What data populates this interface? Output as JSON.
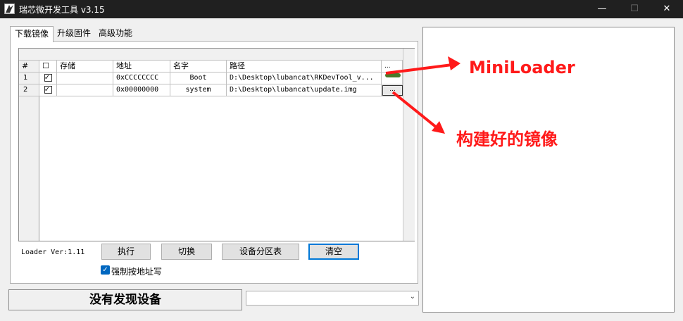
{
  "window": {
    "title": "瑞芯微开发工具 v3.15",
    "minimize_glyph": "—",
    "maximize_glyph": "☐",
    "close_glyph": "✕"
  },
  "tabs": [
    {
      "label": "下载镜像",
      "active": true
    },
    {
      "label": "升级固件",
      "active": false
    },
    {
      "label": "高级功能",
      "active": false
    }
  ],
  "table": {
    "headers": [
      "#",
      "☐",
      "存储",
      "地址",
      "名字",
      "路径",
      "..."
    ],
    "rows": [
      {
        "num": "1",
        "checked": true,
        "storage": "",
        "address": "0xCCCCCCCC",
        "name": "Boot",
        "path": "D:\\Desktop\\lubancat\\RKDevTool_v..."
      },
      {
        "num": "2",
        "checked": true,
        "storage": "",
        "address": "0x00000000",
        "name": "system",
        "path": "D:\\Desktop\\lubancat\\update.img"
      }
    ],
    "browse_label": "..."
  },
  "controls": {
    "loader_version": "Loader Ver:1.11",
    "execute": "执行",
    "switch": "切换",
    "partition_table": "设备分区表",
    "clear": "清空",
    "force_address": "强制按地址写"
  },
  "status": {
    "device_text": "没有发现设备",
    "combo_value": ""
  },
  "annotations": {
    "miniloader": "MiniLoader",
    "built_image": "构建好的镜像",
    "color": "#ff1a1a"
  }
}
